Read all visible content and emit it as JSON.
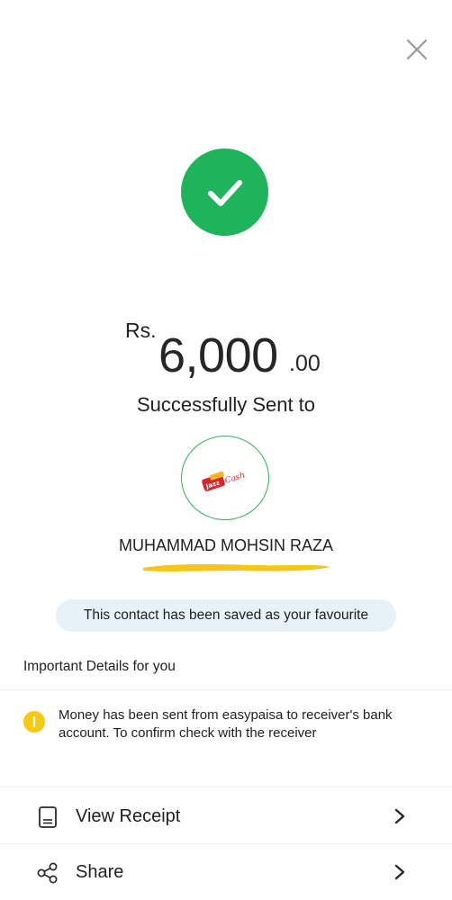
{
  "header": {
    "close_icon": "close-icon"
  },
  "status": {
    "icon": "checkmark-icon",
    "color": "#1fb35b"
  },
  "amount": {
    "currency": "Rs.",
    "whole": "6,000",
    "decimal": ".00"
  },
  "message": {
    "sent_to": "Successfully Sent to"
  },
  "recipient": {
    "logo_icon": "jazzcash-logo-icon",
    "logo_text": "JazzCash",
    "name": "MUHAMMAD MOHSIN RAZA"
  },
  "favourite": {
    "text": "This contact has been saved as your favourite"
  },
  "important": {
    "title": "Important Details for you",
    "message": "Money has been sent from easypaisa to receiver's bank account. To confirm check with the receiver",
    "icon": "info-icon",
    "icon_color": "#f7ca12"
  },
  "actions": [
    {
      "label": "View Receipt",
      "icon": "receipt-icon"
    },
    {
      "label": "Share",
      "icon": "share-icon"
    }
  ],
  "colors": {
    "accent": "#1fb35b",
    "banner": "#e6f2f7",
    "highlight": "#f5c518"
  }
}
